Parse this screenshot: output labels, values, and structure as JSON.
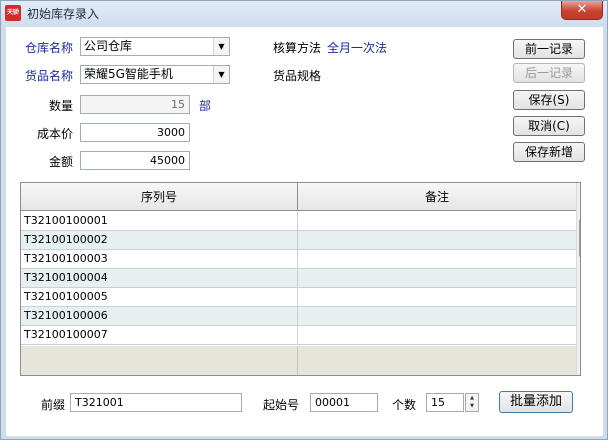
{
  "window": {
    "title": "初始库存录入",
    "app_badge": "天骄",
    "close_glyph": "✕"
  },
  "form": {
    "warehouse_label": "仓库名称",
    "warehouse_value": "公司仓库",
    "goods_label": "货品名称",
    "goods_value": "荣耀5G智能手机",
    "accounting_label": "核算方法",
    "accounting_value": "全月一次法",
    "spec_label": "货品规格",
    "quantity_label": "数量",
    "quantity_value": "15",
    "unit": "部",
    "cost_label": "成本价",
    "cost_value": "3000",
    "amount_label": "金额",
    "amount_value": "45000"
  },
  "buttons": {
    "prev": "前一记录",
    "next": "后一记录",
    "save": "保存(S)",
    "cancel": "取消(C)",
    "save_new": "保存新增"
  },
  "grid": {
    "columns": [
      "序列号",
      "备注"
    ],
    "rows": [
      "T32100100001",
      "T32100100002",
      "T32100100003",
      "T32100100004",
      "T32100100005",
      "T32100100006",
      "T32100100007"
    ]
  },
  "footer": {
    "prefix_label": "前缀",
    "prefix_value": "T321001",
    "start_label": "起始号",
    "start_value": "00001",
    "count_label": "个数",
    "count_value": "15",
    "batch_add": "批量添加"
  },
  "colors": {
    "label_blue": "#1a2aa0",
    "row_alt": "#e7f0f1",
    "close_red": "#c0392b"
  }
}
